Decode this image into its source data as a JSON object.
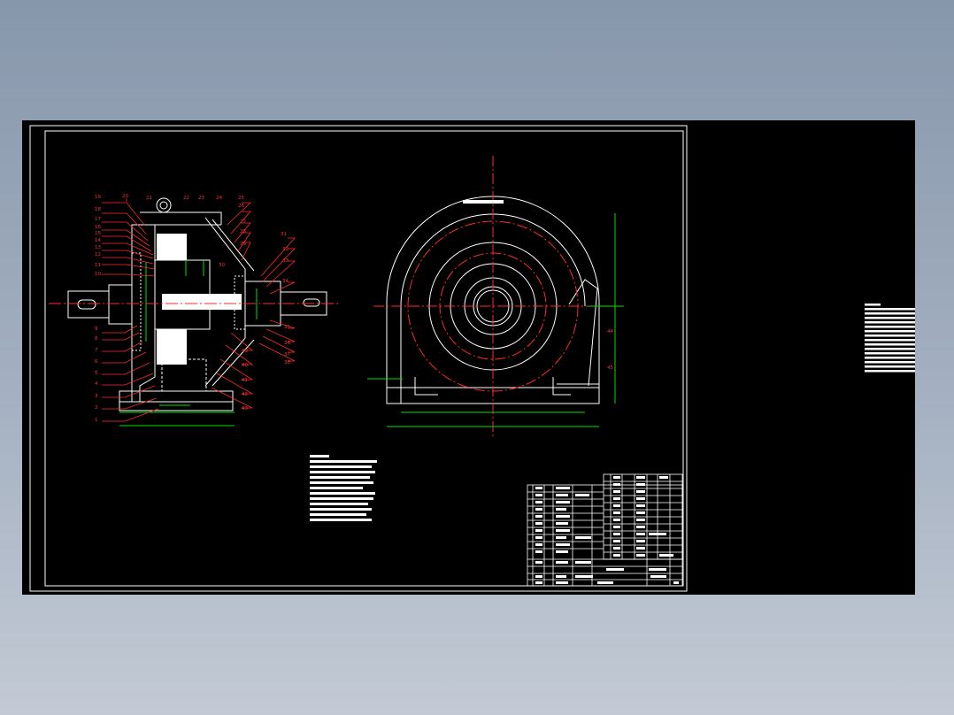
{
  "colors": {
    "background_top": "#8797ab",
    "background_bottom": "#c3cad5",
    "sheet": "#000000",
    "outline": "#ffffff",
    "leader": "#ff2a2a",
    "centerline": "#ff2a2a",
    "dimension": "#00e000"
  },
  "left_view": {
    "callouts_left": [
      "19",
      "18",
      "17",
      "16",
      "15",
      "14",
      "13",
      "12",
      "11",
      "10",
      "9",
      "8",
      "7",
      "6",
      "5",
      "4",
      "3",
      "2",
      "1"
    ],
    "callouts_top": [
      "20",
      "21",
      "22",
      "23",
      "24",
      "25",
      "26"
    ],
    "callouts_right": [
      "27",
      "28",
      "29",
      "30",
      "31",
      "32",
      "33",
      "34",
      "35",
      "36",
      "37",
      "38",
      "39",
      "40",
      "41",
      "42",
      "43"
    ]
  },
  "right_view": {
    "callouts_right": [
      "44",
      "45"
    ]
  }
}
